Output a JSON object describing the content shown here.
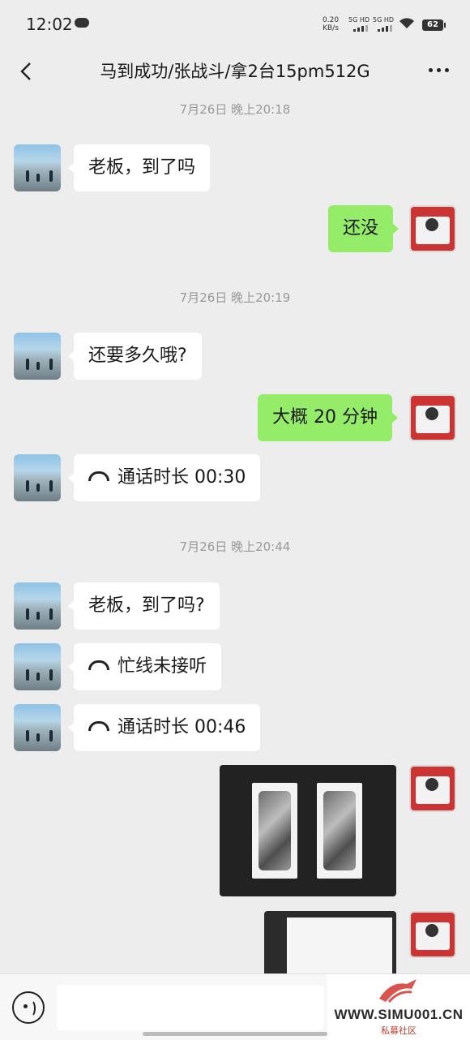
{
  "status": {
    "time": "12:02",
    "net_speed": "0.20",
    "net_unit": "KB/s",
    "sim1": "5G HD",
    "sim2": "5G HD",
    "battery": "62"
  },
  "header": {
    "title": "马到成功/张战斗/拿2台15pm512G"
  },
  "messages": {
    "ts1": "7月26日 晚上20:18",
    "m1": "老板，到了吗",
    "m2": "还没",
    "ts2": "7月26日 晚上20:19",
    "m3": "还要多久哦?",
    "m4": "大概 20 分钟",
    "m5": "通话时长 00:30",
    "ts3": "7月26日 晚上20:44",
    "m6": "老板，到了吗?",
    "m7": "忙线未接听",
    "m8": "通话时长 00:46"
  },
  "watermark": {
    "text": "WWW.SIMU001.CN",
    "sub": "私募社区"
  },
  "colors": {
    "bg": "#ededed",
    "bubble_out": "#95ec69",
    "bubble_in": "#ffffff"
  }
}
